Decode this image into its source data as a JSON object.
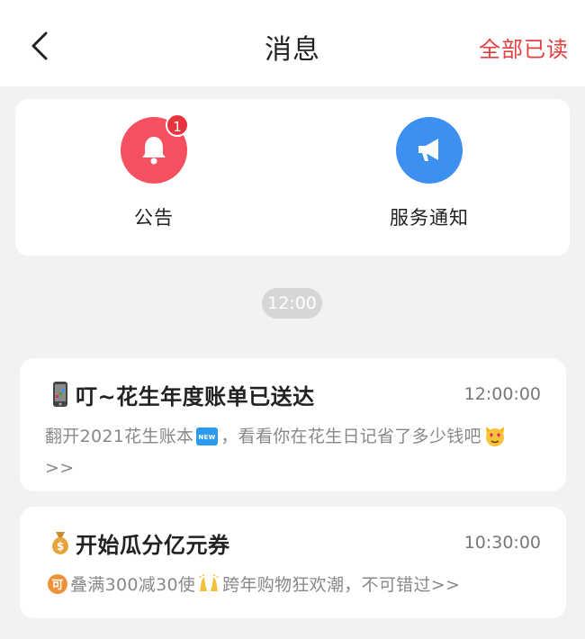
{
  "header": {
    "title": "消息",
    "mark_all_read": "全部已读"
  },
  "categories": [
    {
      "label": "公告",
      "badge": "1",
      "icon": "bell-icon",
      "color": "#f5505f"
    },
    {
      "label": "服务通知",
      "icon": "megaphone-icon",
      "color": "#3d8ff0"
    }
  ],
  "time_divider": "12:00",
  "messages": [
    {
      "icon": "mobile-phone-icon",
      "title": "叮~花生年度账单已送达",
      "time": "12:00:00",
      "body_part1": "翻开2021花生账本",
      "body_part2": "，看看你在花生日记省了多少钱吧",
      "more": ">>"
    },
    {
      "icon": "money-bag-icon",
      "title": "开始瓜分亿元券",
      "time": "10:30:00",
      "body_part1": "叠满300减30使",
      "body_part2": "跨年购物狂欢潮，不可错过>>"
    }
  ]
}
